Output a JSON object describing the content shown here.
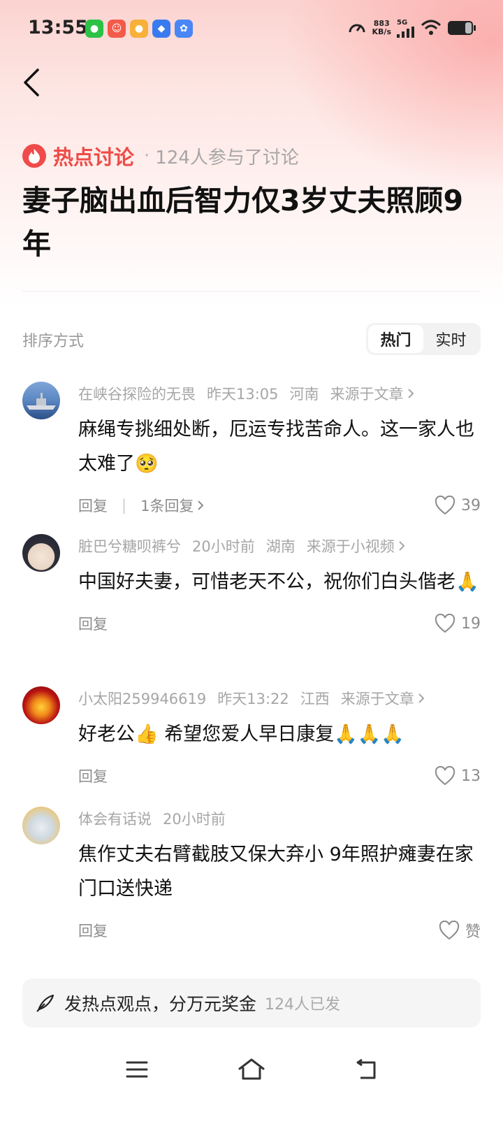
{
  "status_bar": {
    "time": "13:55",
    "net_speed_value": "883",
    "net_speed_unit": "KB/s",
    "network": "5G"
  },
  "topic": {
    "tag_label": "热点讨论",
    "separator": "·",
    "participants": "124人参与了讨论",
    "title": "妻子脑出血后智力仅3岁丈夫照顾9年"
  },
  "sort": {
    "label": "排序方式",
    "options": [
      "热门",
      "实时"
    ],
    "active": "热门"
  },
  "comments": [
    {
      "user": "在峡谷探险的无畏",
      "time": "昨天13:05",
      "location": "河南",
      "source": "来源于文章",
      "content": "麻绳专挑细处断，厄运专找苦命人。这一家人也太难了🥺",
      "reply_label": "回复",
      "replies": "1条回复",
      "likes": "39"
    },
    {
      "user": "脏巴兮糖呗裤兮",
      "time": "20小时前",
      "location": "湖南",
      "source": "来源于小视频",
      "content": "中国好夫妻，可惜老天不公，祝你们白头偕老🙏",
      "reply_label": "回复",
      "likes": "19"
    },
    {
      "user": "小太阳259946619",
      "time": "昨天13:22",
      "location": "江西",
      "source": "来源于文章",
      "content": "好老公👍 希望您爱人早日康复🙏🙏🙏",
      "reply_label": "回复",
      "likes": "13"
    },
    {
      "user": "体会有话说",
      "time": "20小时前",
      "content": "焦作丈夫右臂截肢又保大弃小 9年照护瘫妻在家门口送快递",
      "reply_label": "回复",
      "likes": "赞"
    }
  ],
  "post_bar": {
    "text": "发热点观点，分万元奖金",
    "count": "124人已发"
  },
  "colors": {
    "accent": "#ee4b47",
    "muted": "#a6a6a6"
  }
}
